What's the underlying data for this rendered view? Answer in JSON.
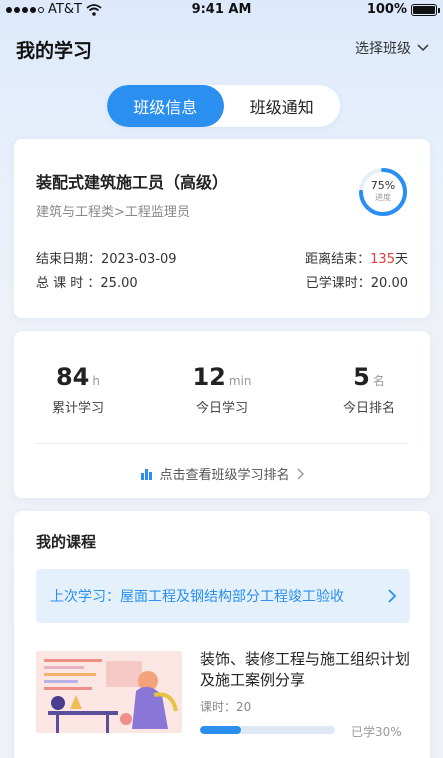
{
  "status_bar": {
    "carrier": "AT&T",
    "time": "9:41 AM",
    "battery": "100%"
  },
  "header": {
    "title": "我的学习",
    "class_select_label": "选择班级"
  },
  "tabs": [
    {
      "label": "班级信息",
      "active": true
    },
    {
      "label": "班级通知",
      "active": false
    }
  ],
  "class_card": {
    "title": "装配式建筑施工员（高级）",
    "subtitle": "建筑与工程类>工程监理员",
    "progress_text": "75%",
    "progress_sub": "进度",
    "progress_value": 0.75,
    "end_date_label": "结束日期：",
    "end_date": "2023-03-09",
    "total_hours_label": "总 课 时 ：",
    "total_hours": "25.00",
    "remaining_label": "距离结束：",
    "remaining_days": "135",
    "remaining_unit": "天",
    "studied_label": "已学课时：",
    "studied_hours": "20.00"
  },
  "stats": {
    "items": [
      {
        "value": "84",
        "unit": "h",
        "label": "累计学习"
      },
      {
        "value": "12",
        "unit": "min",
        "label": "今日学习"
      },
      {
        "value": "5",
        "unit": "名",
        "label": "今日排名"
      }
    ],
    "rank_link": "点击查看班级学习排名"
  },
  "courses": {
    "heading": "我的课程",
    "last_study": "上次学习：屋面工程及钢结构部分工程竣工验收",
    "course": {
      "title": "装饰、装修工程与施工组织计划及施工案例分享",
      "hours_label": "课时：",
      "hours": "20",
      "progress_label": "已学30%",
      "progress_value": 0.3
    }
  },
  "colors": {
    "accent": "#2b8ff0",
    "warning": "#e03a3a"
  },
  "icons": {
    "wifi": "wifi-icon",
    "chevron_down": "chevron-down-icon",
    "chart": "bar-chart-icon",
    "chevron_right": "chevron-right-icon"
  }
}
